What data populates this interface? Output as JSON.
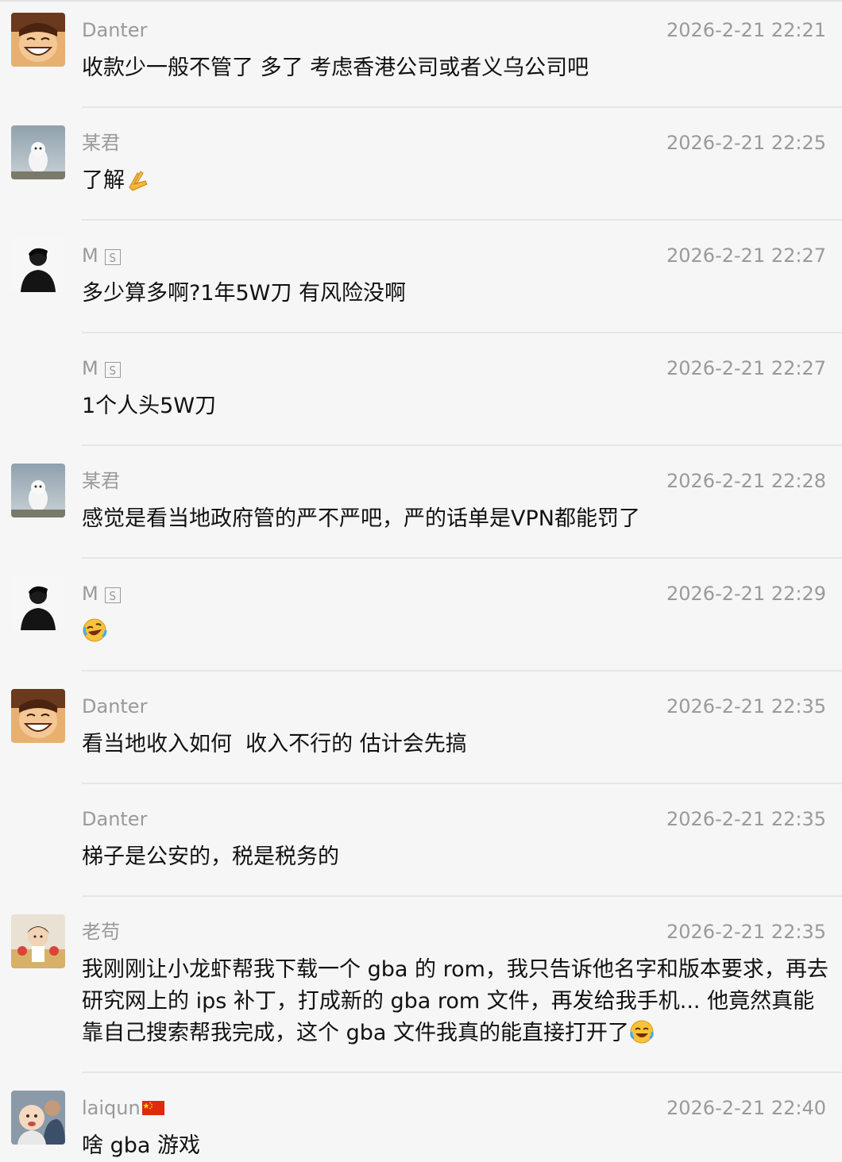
{
  "messages": [
    {
      "sender": "Danter",
      "time": "2026-2-21 22:21",
      "text": "收款少一般不管了 多了 考虑香港公司或者义乌公司吧",
      "avatar": "anime-avatar"
    },
    {
      "sender": "某君",
      "time": "2026-2-21 22:25",
      "text": "了解",
      "emoji": "pray-emoji",
      "avatar": "owl-avatar"
    },
    {
      "sender": "M",
      "badge": "S",
      "time": "2026-2-21 22:27",
      "text": "多少算多啊?1年5W刀 有风险没啊",
      "avatar": "silhouette-avatar"
    },
    {
      "sender": "M",
      "badge": "S",
      "time": "2026-2-21 22:27",
      "text": "1个人头5W刀"
    },
    {
      "sender": "某君",
      "time": "2026-2-21 22:28",
      "text": "感觉是看当地政府管的严不严吧，严的话单是VPN都能罚了",
      "avatar": "owl-avatar"
    },
    {
      "sender": "M",
      "badge": "S",
      "time": "2026-2-21 22:29",
      "text": "",
      "emoji": "rofl-emoji",
      "avatar": "silhouette-avatar"
    },
    {
      "sender": "Danter",
      "time": "2026-2-21 22:35",
      "text": "看当地收入如何  收入不行的 估计会先搞",
      "avatar": "anime-avatar"
    },
    {
      "sender": "Danter",
      "time": "2026-2-21 22:35",
      "text": "梯子是公安的，税是税务的"
    },
    {
      "sender": "老苟",
      "time": "2026-2-21 22:35",
      "text": "我刚刚让小龙虾帮我下载一个 gba 的 rom，我只告诉他名字和版本要求，再去研究网上的 ips 补丁，打成新的 gba rom 文件，再发给我手机... 他竟然真能靠自己搜索帮我完成，这个 gba 文件我真的能直接打开了",
      "emoji": "joy-emoji",
      "avatar": "child-avatar"
    },
    {
      "sender": "laiqun",
      "flag": "china-flag-icon",
      "time": "2026-2-21 22:40",
      "text": "啥 gba 游戏",
      "avatar": "baby-avatar"
    }
  ]
}
